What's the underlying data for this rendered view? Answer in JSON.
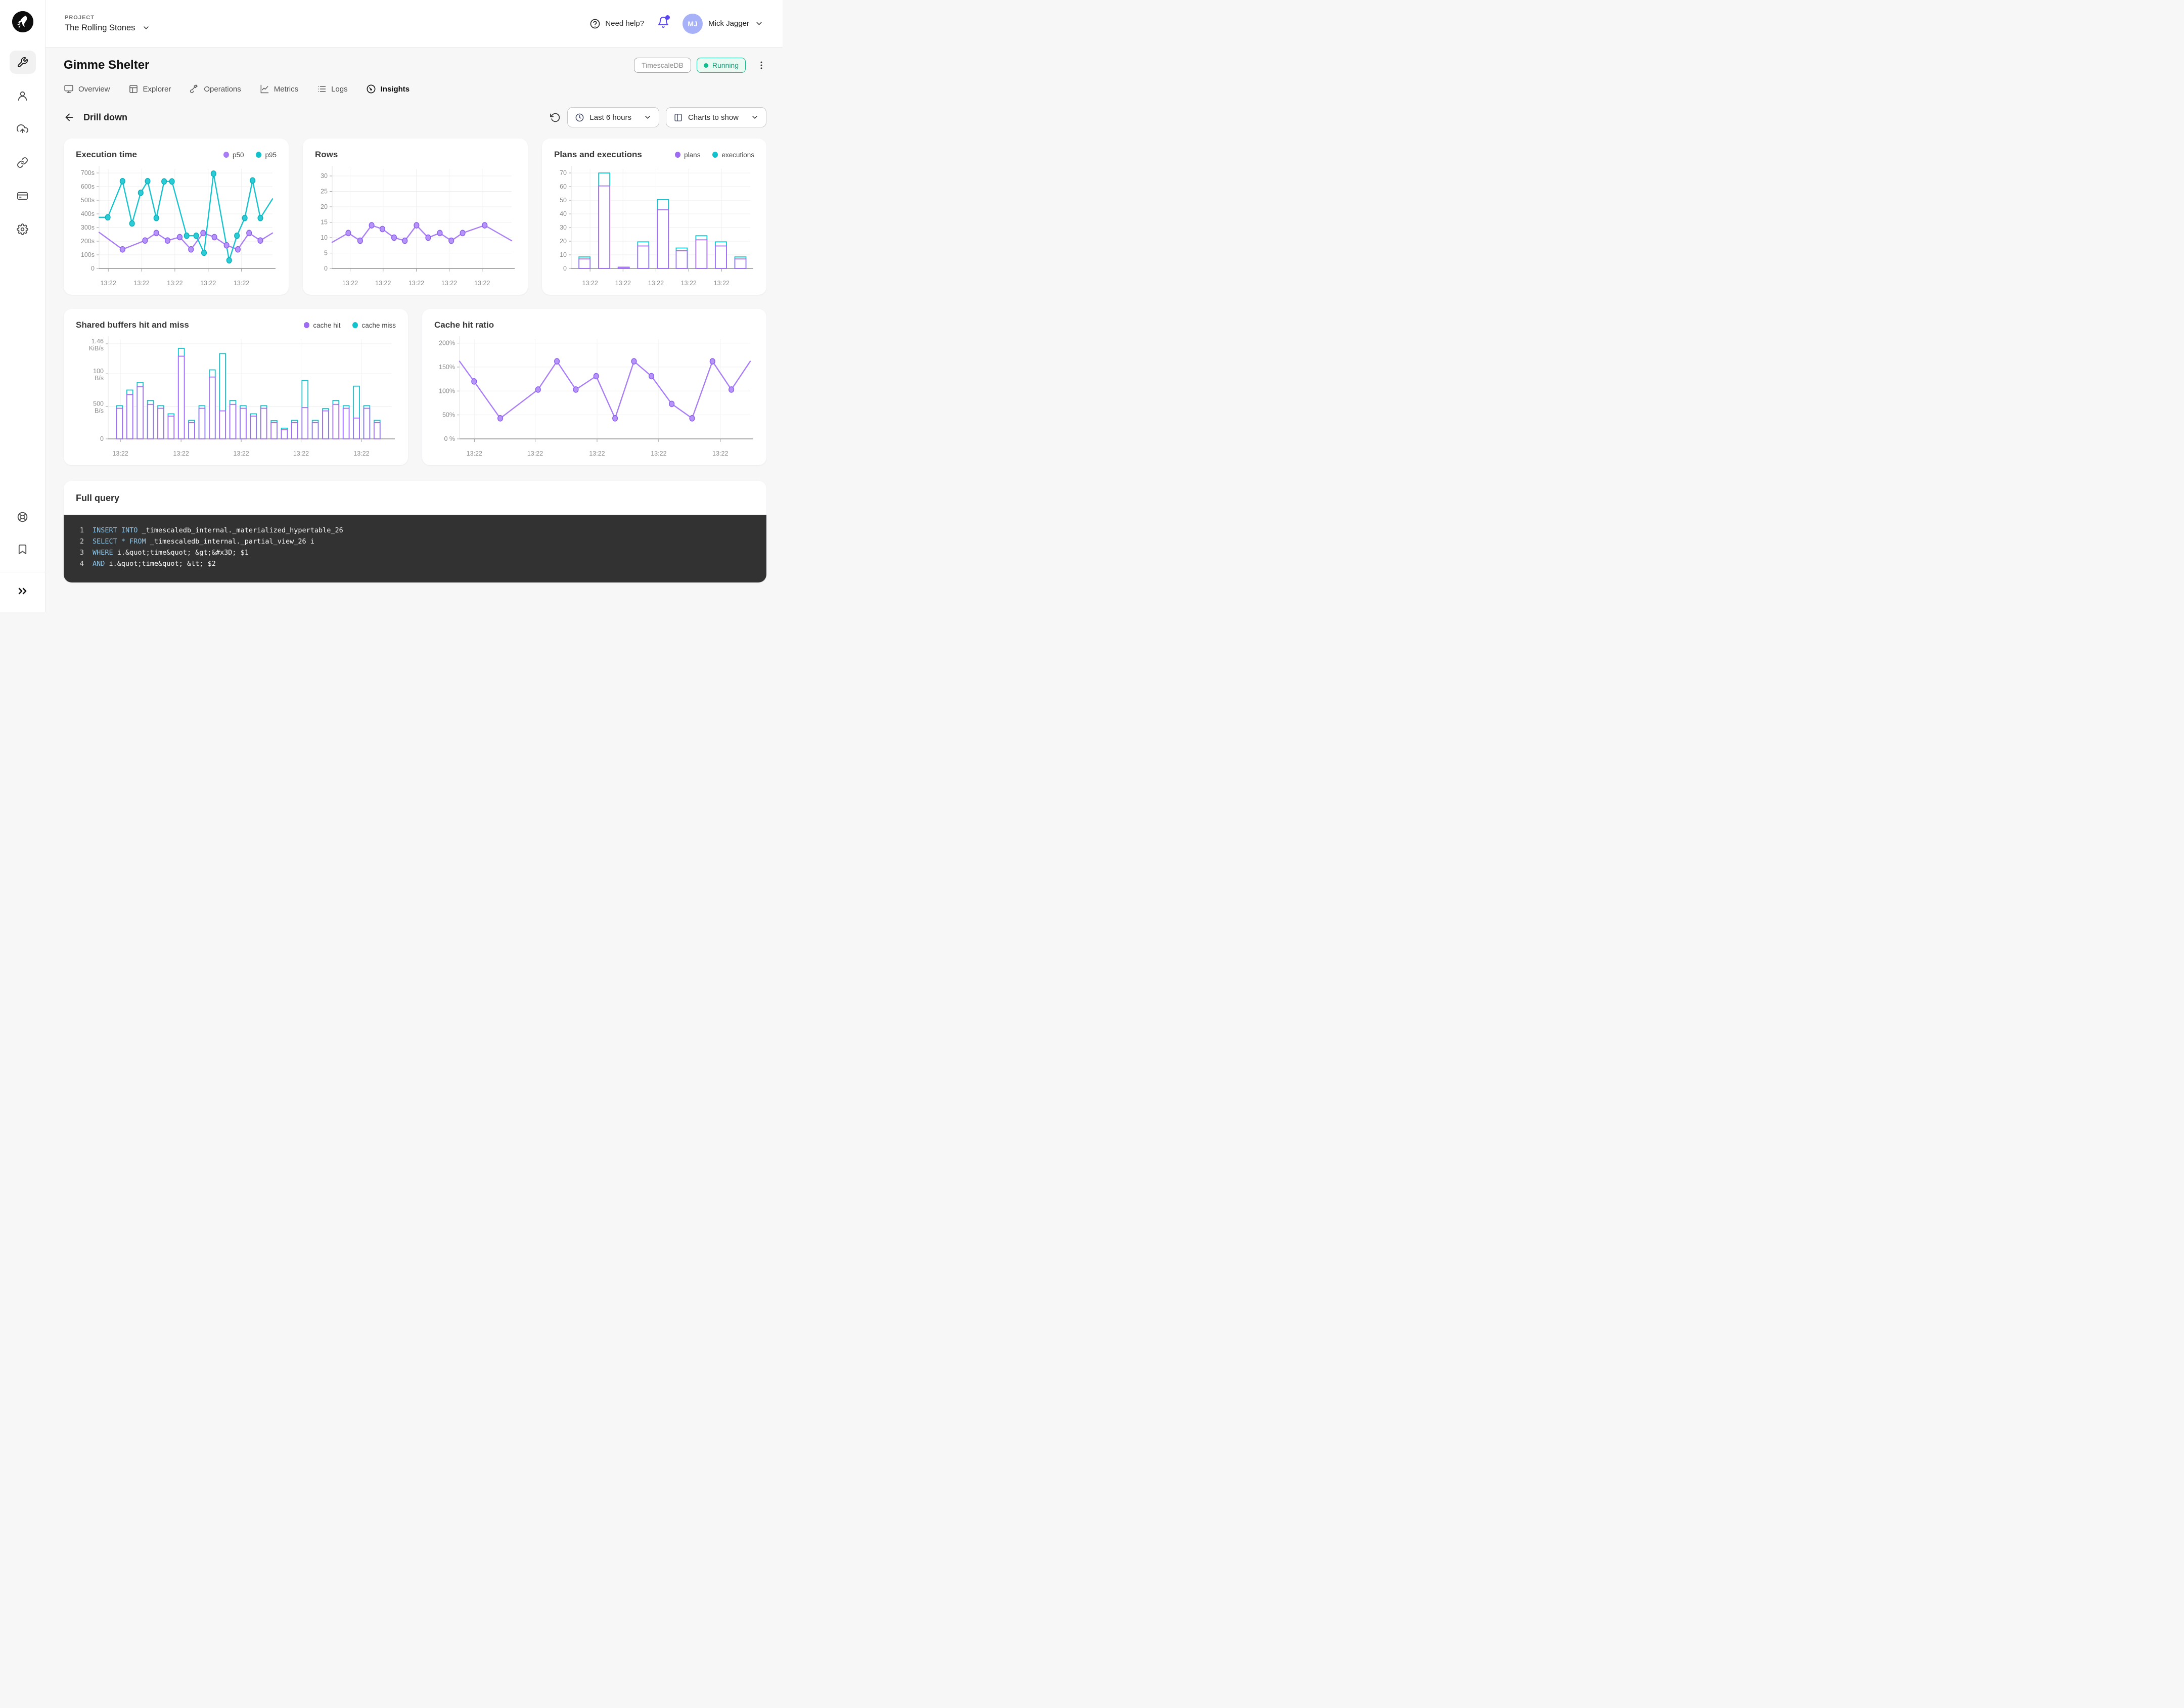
{
  "theme": {
    "accent_purple": "#5a47f2",
    "chart_purple": "#a07af4",
    "chart_teal": "#14c3cd",
    "running_green": "#10bd8d",
    "code_bg": "#323232",
    "code_keyword": "#8ac4e9"
  },
  "header": {
    "project_label": "PROJECT",
    "project_name": "The Rolling Stones",
    "help_label": "Need help?",
    "user_initials": "MJ",
    "user_name": "Mick Jagger"
  },
  "page": {
    "title": "Gimme Shelter",
    "db_badge": "TimescaleDB",
    "status": "Running",
    "drill_title": "Drill down",
    "time_range": "Last 6 hours",
    "charts_to_show": "Charts to show"
  },
  "tabs": [
    {
      "label": "Overview",
      "active": false
    },
    {
      "label": "Explorer",
      "active": false
    },
    {
      "label": "Operations",
      "active": false
    },
    {
      "label": "Metrics",
      "active": false
    },
    {
      "label": "Logs",
      "active": false
    },
    {
      "label": "Insights",
      "active": true
    }
  ],
  "chart_data": [
    {
      "type": "line",
      "title": "Execution time",
      "show_legend": true,
      "ylim": [
        0,
        730
      ],
      "xlabel": "13:22",
      "yticks": [
        {
          "v": 0,
          "label": "0"
        },
        {
          "v": 100,
          "label": "100s"
        },
        {
          "v": 200,
          "label": "200s"
        },
        {
          "v": 300,
          "label": "300s"
        },
        {
          "v": 400,
          "label": "400s"
        },
        {
          "v": 500,
          "label": "500s"
        },
        {
          "v": 600,
          "label": "600s"
        },
        {
          "v": 700,
          "label": "700s"
        }
      ],
      "xticks": [
        5.3,
        24.5,
        43.7,
        62.9,
        82.1
      ],
      "layout": {
        "ml": 48
      },
      "series": [
        {
          "name": "p50",
          "color": "#a97df5",
          "fill": "#b795f8",
          "stroke": "#8d5ff0",
          "points": [
            [
              0,
              265
            ],
            [
              13.5,
              140
            ],
            [
              26.5,
              205
            ],
            [
              33,
              260
            ],
            [
              39.5,
              205
            ],
            [
              46.5,
              230
            ],
            [
              53,
              140
            ],
            [
              60,
              260
            ],
            [
              66.5,
              230
            ],
            [
              73.5,
              170
            ],
            [
              80,
              140
            ],
            [
              86.5,
              260
            ],
            [
              93,
              205
            ],
            [
              100,
              260
            ]
          ]
        },
        {
          "name": "p95",
          "color": "#14c3cd",
          "fill": "#2bccd5",
          "stroke": "#0bb0bb",
          "points": [
            [
              0,
              375
            ],
            [
              5,
              375
            ],
            [
              13.5,
              640
            ],
            [
              19,
              330
            ],
            [
              24,
              555
            ],
            [
              28,
              640
            ],
            [
              33,
              370
            ],
            [
              37.5,
              638
            ],
            [
              42,
              638
            ],
            [
              50.5,
              240
            ],
            [
              56,
              240
            ],
            [
              60.5,
              115
            ],
            [
              66,
              695
            ],
            [
              75,
              60
            ],
            [
              79.5,
              240
            ],
            [
              84,
              370
            ],
            [
              88.5,
              645
            ],
            [
              93,
              370
            ],
            [
              100,
              510
            ]
          ]
        }
      ]
    },
    {
      "type": "line",
      "title": "Rows",
      "show_legend": false,
      "ylim": [
        0,
        32.3
      ],
      "xlabel": "13:22",
      "yticks": [
        {
          "v": 0,
          "label": "0"
        },
        {
          "v": 5,
          "label": "5"
        },
        {
          "v": 10,
          "label": "10"
        },
        {
          "v": 15,
          "label": "15"
        },
        {
          "v": 20,
          "label": "20"
        },
        {
          "v": 25,
          "label": "25"
        },
        {
          "v": 30,
          "label": "30"
        }
      ],
      "xticks": [
        10,
        28.4,
        46.9,
        65.2,
        83.6
      ],
      "layout": {
        "ml": 36
      },
      "series": [
        {
          "name": "rows",
          "color": "#a97df5",
          "fill": "#b795f8",
          "stroke": "#8d5ff0",
          "points": [
            [
              0,
              8.5
            ],
            [
              9,
              11.5
            ],
            [
              15.6,
              9
            ],
            [
              22,
              14
            ],
            [
              28,
              12.8
            ],
            [
              34.5,
              10
            ],
            [
              40.5,
              9
            ],
            [
              47,
              14
            ],
            [
              53.5,
              10
            ],
            [
              60,
              11.5
            ],
            [
              66.4,
              9
            ],
            [
              72.7,
              11.5
            ],
            [
              85,
              14
            ],
            [
              100,
              9
            ]
          ]
        }
      ]
    },
    {
      "type": "bar",
      "title": "Plans and executions",
      "show_legend": true,
      "ylim": [
        0,
        73
      ],
      "xlabel": "13:22",
      "yticks": [
        {
          "v": 0,
          "label": "0"
        },
        {
          "v": 10,
          "label": "10"
        },
        {
          "v": 20,
          "label": "20"
        },
        {
          "v": 30,
          "label": "30"
        },
        {
          "v": 40,
          "label": "40"
        },
        {
          "v": 50,
          "label": "50"
        },
        {
          "v": 60,
          "label": "60"
        },
        {
          "v": 70,
          "label": "70"
        }
      ],
      "xticks": [
        10.5,
        28.9,
        47.3,
        65.6,
        84
      ],
      "layout": {
        "ml": 36
      },
      "bar_centers": [
        7.4,
        18.4,
        29.3,
        40.2,
        51.2,
        61.7,
        72.7,
        83.6,
        94.5
      ],
      "bar_width": 6.2,
      "series": [
        {
          "name": "plans",
          "color": "#9e6cf2",
          "values": [
            7,
            60.5,
            0.8,
            16.5,
            43,
            13,
            21,
            16.5,
            7
          ]
        },
        {
          "name": "executions",
          "color": "#12c3cd",
          "values": [
            8.5,
            70,
            1,
            19.5,
            50.5,
            15,
            24,
            19.5,
            8.5
          ]
        }
      ]
    },
    {
      "type": "bar",
      "title": "Shared buffers hit and miss",
      "show_legend": true,
      "ylim": [
        0,
        1530
      ],
      "xlabel": "13:22",
      "yticks": [
        {
          "v": 0,
          "label": "0"
        },
        {
          "v": 500,
          "label": "500\nB/s"
        },
        {
          "v": 1000,
          "label": "100\nB/s"
        },
        {
          "v": 1460,
          "label": "1.46\nKiB/s"
        }
      ],
      "xticks": [
        4.3,
        25.7,
        46.9,
        68,
        89.3
      ],
      "layout": {
        "ml": 66
      },
      "bar_centers": [
        4,
        7.63,
        11.26,
        14.9,
        18.53,
        22.16,
        25.79,
        29.42,
        33.06,
        36.69,
        40.32,
        43.95,
        47.58,
        51.22,
        54.85,
        58.48,
        62.11,
        65.74,
        69.38,
        73.01,
        76.64,
        80.27,
        83.9,
        87.54,
        91.17,
        94.8
      ],
      "bar_width": 2.1,
      "series": [
        {
          "name": "cache hit",
          "color": "#9e6cf2",
          "values": [
            470,
            680,
            800,
            530,
            470,
            350,
            1270,
            250,
            470,
            950,
            430,
            530,
            470,
            350,
            470,
            250,
            140,
            250,
            480,
            250,
            430,
            530,
            470,
            320,
            470,
            250
          ]
        },
        {
          "name": "cache miss",
          "color": "#12c3cd",
          "values": [
            510,
            750,
            870,
            590,
            510,
            385,
            1390,
            285,
            510,
            1060,
            1310,
            590,
            510,
            385,
            510,
            280,
            165,
            285,
            900,
            285,
            465,
            590,
            510,
            810,
            510,
            285
          ]
        }
      ]
    },
    {
      "type": "line",
      "title": "Cache hit ratio",
      "show_legend": false,
      "ylim": [
        0,
        208
      ],
      "xlabel": "13:22",
      "yticks": [
        {
          "v": 0,
          "label": "0 %"
        },
        {
          "v": 50,
          "label": "50%"
        },
        {
          "v": 100,
          "label": "100%"
        },
        {
          "v": 150,
          "label": "150%"
        },
        {
          "v": 200,
          "label": "200%"
        }
      ],
      "xticks": [
        5.1,
        26,
        47.3,
        68.5,
        89.7
      ],
      "layout": {
        "ml": 52
      },
      "series": [
        {
          "name": "cache hit ratio",
          "color": "#a97df5",
          "fill": "#b795f8",
          "stroke": "#8d5ff0",
          "points": [
            [
              0,
              162
            ],
            [
              5,
              120
            ],
            [
              14,
              43
            ],
            [
              27,
              103
            ],
            [
              33.5,
              162
            ],
            [
              40,
              103
            ],
            [
              47,
              131
            ],
            [
              53.5,
              43
            ],
            [
              60,
              162
            ],
            [
              66,
              131
            ],
            [
              73,
              73
            ],
            [
              80,
              43
            ],
            [
              87,
              162
            ],
            [
              93.5,
              103
            ],
            [
              100,
              162
            ]
          ]
        }
      ]
    }
  ],
  "full_query": {
    "title": "Full query",
    "lines": [
      {
        "num": "1",
        "kw": "INSERT INTO",
        "rest": " _timescaledb_internal._materialized_hypertable_26"
      },
      {
        "num": "2",
        "kw": "SELECT * FROM",
        "rest": " _timescaledb_internal._partial_view_26 i"
      },
      {
        "num": "3",
        "kw": "WHERE",
        "rest": " i.&quot;time&quot; &gt;&#x3D; $1"
      },
      {
        "num": "4",
        "kw": "AND",
        "rest": " i.&quot;time&quot; &lt; $2"
      }
    ]
  }
}
